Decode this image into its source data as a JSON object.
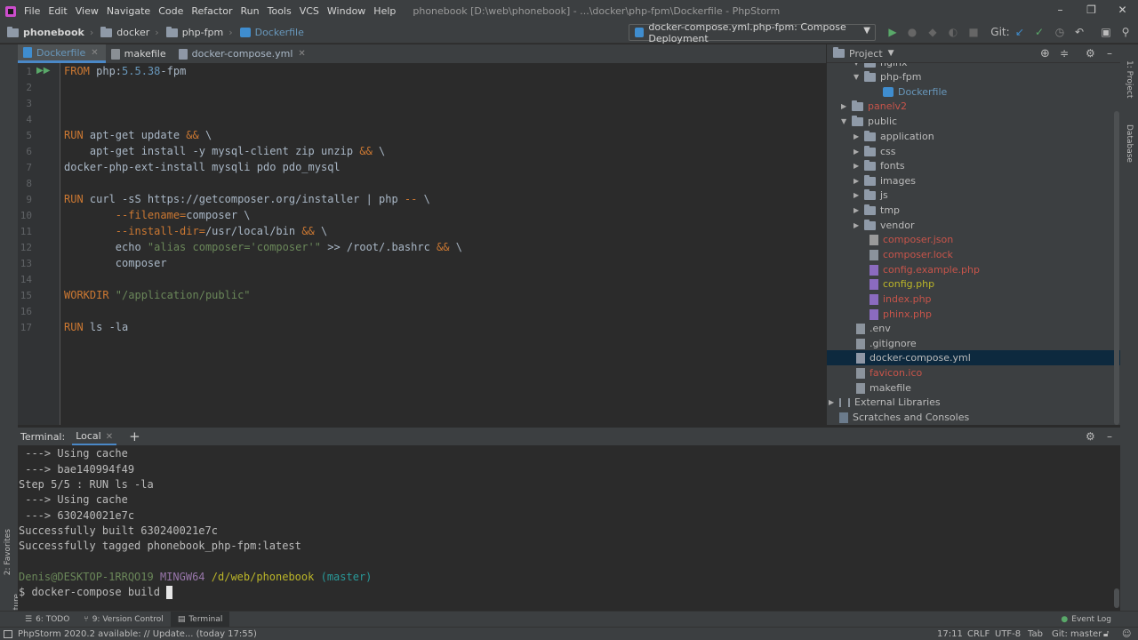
{
  "menu": {
    "items": [
      "File",
      "Edit",
      "View",
      "Navigate",
      "Code",
      "Refactor",
      "Run",
      "Tools",
      "VCS",
      "Window",
      "Help"
    ],
    "window_title": "phonebook [D:\\web\\phonebook] - ...\\docker\\php-fpm\\Dockerfile - PhpStorm"
  },
  "breadcrumb": [
    "phonebook",
    "docker",
    "php-fpm",
    "Dockerfile"
  ],
  "run_config": "docker-compose.yml.php-fpm: Compose Deployment",
  "git_label": "Git:",
  "editor_tabs": [
    {
      "label": "Dockerfile",
      "active": true
    },
    {
      "label": "makefile",
      "active": false
    },
    {
      "label": "docker-compose.yml",
      "active": false
    }
  ],
  "line_numbers": [
    "1",
    "2",
    "3",
    "4",
    "5",
    "6",
    "7",
    "8",
    "9",
    "10",
    "11",
    "12",
    "13",
    "14",
    "15",
    "16",
    "17"
  ],
  "code": {
    "l1_kw": "FROM",
    "l1_rest": " php:",
    "l1_ver": "5.5.38",
    "l1_tail": "-fpm",
    "l5_kw": "RUN",
    "l5_rest": " apt-get update ",
    "l5_amp": "&&",
    "l5_tail": " \\",
    "l6_rest": "    apt-get install -y mysql-client zip unzip ",
    "l6_amp": "&&",
    "l6_tail": " \\",
    "l7": "docker-php-ext-install mysqli pdo pdo_mysql",
    "l9_kw": "RUN",
    "l9_rest": " curl -sS https://getcomposer.org/installer | php ",
    "l9_dd": "--",
    "l9_tail": " \\",
    "l10_a": "        ",
    "l10_opt": "--filename=",
    "l10_b": "composer \\",
    "l11_a": "        ",
    "l11_opt": "--install-dir=",
    "l11_b": "/usr/local/bin ",
    "l11_amp": "&&",
    "l11_tail": " \\",
    "l12_a": "        echo ",
    "l12_str": "\"alias composer='composer'\"",
    "l12_b": " >> /root/.bashrc ",
    "l12_amp": "&&",
    "l12_tail": " \\",
    "l13": "        composer",
    "l15_kw": "WORKDIR",
    "l15_str": " \"/application/public\"",
    "l17_kw": "RUN",
    "l17_rest": " ls -la"
  },
  "project": {
    "title": "Project",
    "tree": [
      {
        "label": "nginx",
        "kind": "folder",
        "color": "default",
        "expanded": true
      },
      {
        "label": "php-fpm",
        "kind": "folder",
        "color": "default",
        "expanded": true
      },
      {
        "label": "Dockerfile",
        "kind": "docker",
        "color": "blue"
      },
      {
        "label": "panelv2",
        "kind": "folder",
        "color": "red",
        "expanded": false
      },
      {
        "label": "public",
        "kind": "folder",
        "color": "default",
        "expanded": true
      },
      {
        "label": "application",
        "kind": "folder",
        "color": "default",
        "expanded": false
      },
      {
        "label": "css",
        "kind": "folder",
        "color": "default",
        "expanded": false
      },
      {
        "label": "fonts",
        "kind": "folder",
        "color": "default",
        "expanded": false
      },
      {
        "label": "images",
        "kind": "folder",
        "color": "default",
        "expanded": false
      },
      {
        "label": "js",
        "kind": "folder",
        "color": "default",
        "expanded": false
      },
      {
        "label": "tmp",
        "kind": "folder",
        "color": "default",
        "expanded": false
      },
      {
        "label": "vendor",
        "kind": "folder",
        "color": "default",
        "expanded": false
      },
      {
        "label": "composer.json",
        "kind": "json",
        "color": "red"
      },
      {
        "label": "composer.lock",
        "kind": "file",
        "color": "red"
      },
      {
        "label": "config.example.php",
        "kind": "php",
        "color": "red"
      },
      {
        "label": "config.php",
        "kind": "php",
        "color": "yellow"
      },
      {
        "label": "index.php",
        "kind": "php",
        "color": "red"
      },
      {
        "label": "phinx.php",
        "kind": "php",
        "color": "red"
      },
      {
        "label": ".env",
        "kind": "file",
        "color": "default"
      },
      {
        "label": ".gitignore",
        "kind": "file",
        "color": "default"
      },
      {
        "label": "docker-compose.yml",
        "kind": "file",
        "color": "default",
        "selected": true
      },
      {
        "label": "favicon.ico",
        "kind": "file",
        "color": "red"
      },
      {
        "label": "makefile",
        "kind": "file",
        "color": "default"
      },
      {
        "label": "External Libraries",
        "kind": "lib",
        "color": "default"
      },
      {
        "label": "Scratches and Consoles",
        "kind": "scratch",
        "color": "default"
      }
    ]
  },
  "terminal": {
    "label": "Terminal:",
    "tab": "Local",
    "lines": [
      " ---> Using cache",
      " ---> bae140994f49",
      "Step 5/5 : RUN ls -la",
      " ---> Using cache",
      " ---> 630240021e7c",
      "Successfully built 630240021e7c",
      "Successfully tagged phonebook_php-fpm:latest"
    ],
    "prompt_user": "Denis@DESKTOP-1RRQO19",
    "prompt_env": "MINGW64",
    "prompt_path": "/d/web/phonebook",
    "prompt_branch": "(master)",
    "command": "$ docker-compose build "
  },
  "bottom_tabs": [
    "6: TODO",
    "9: Version Control",
    "Terminal"
  ],
  "event_log": "Event Log",
  "side_labels": {
    "left_top": "1: Project",
    "right_db": "Database",
    "favorites": "2: Favorites",
    "structure": "Z: Structure"
  },
  "status": {
    "message": "PhpStorm 2020.2 available: // Update... (today 17:55)",
    "position": "17:11",
    "line_sep": "CRLF",
    "encoding": "UTF-8",
    "indent": "Tab",
    "git": "Git: master"
  }
}
